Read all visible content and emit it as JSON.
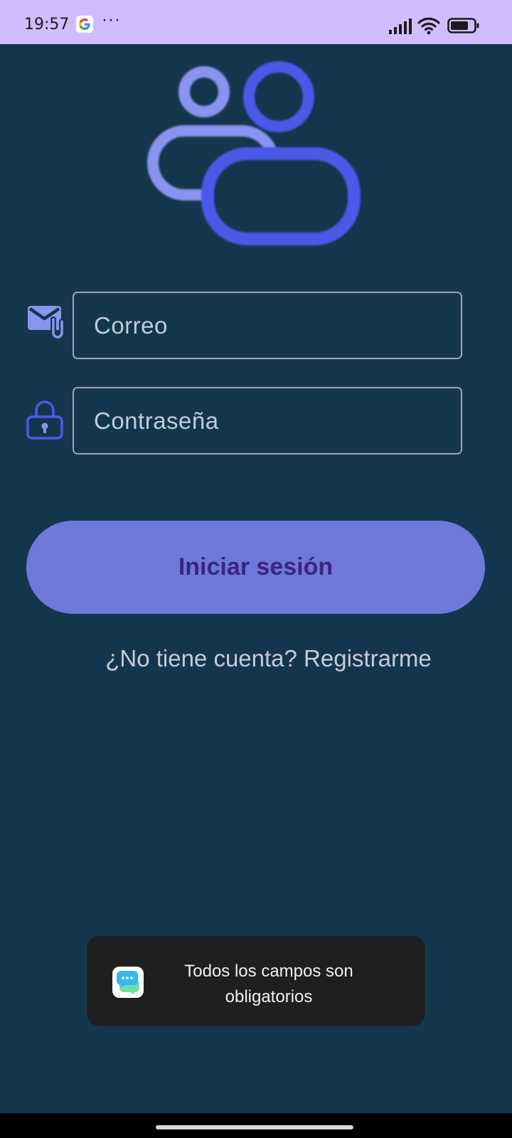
{
  "status_bar": {
    "time": "19:57",
    "more": "···",
    "icons": [
      "google-icon",
      "signal-icon",
      "wifi-icon",
      "battery-icon"
    ]
  },
  "logo": {
    "icon": "users-icon"
  },
  "form": {
    "email": {
      "placeholder": "Correo",
      "value": "",
      "icon": "mail-icon"
    },
    "password": {
      "placeholder": "Contraseña",
      "value": "",
      "icon": "lock-icon"
    },
    "login_label": "Iniciar sesión",
    "register_text": "¿No tiene cuenta? Registrarme"
  },
  "toast": {
    "line1": "Todos los campos son",
    "line2": "obligatorios",
    "icon": "chat-bubble-icon"
  },
  "colors": {
    "background": "#14364d",
    "status_bar": "#d1bdfd",
    "accent": "#4a5ae8",
    "accent_light": "#8b93f0",
    "button": "#6e79d9",
    "button_text": "#3a2580"
  }
}
